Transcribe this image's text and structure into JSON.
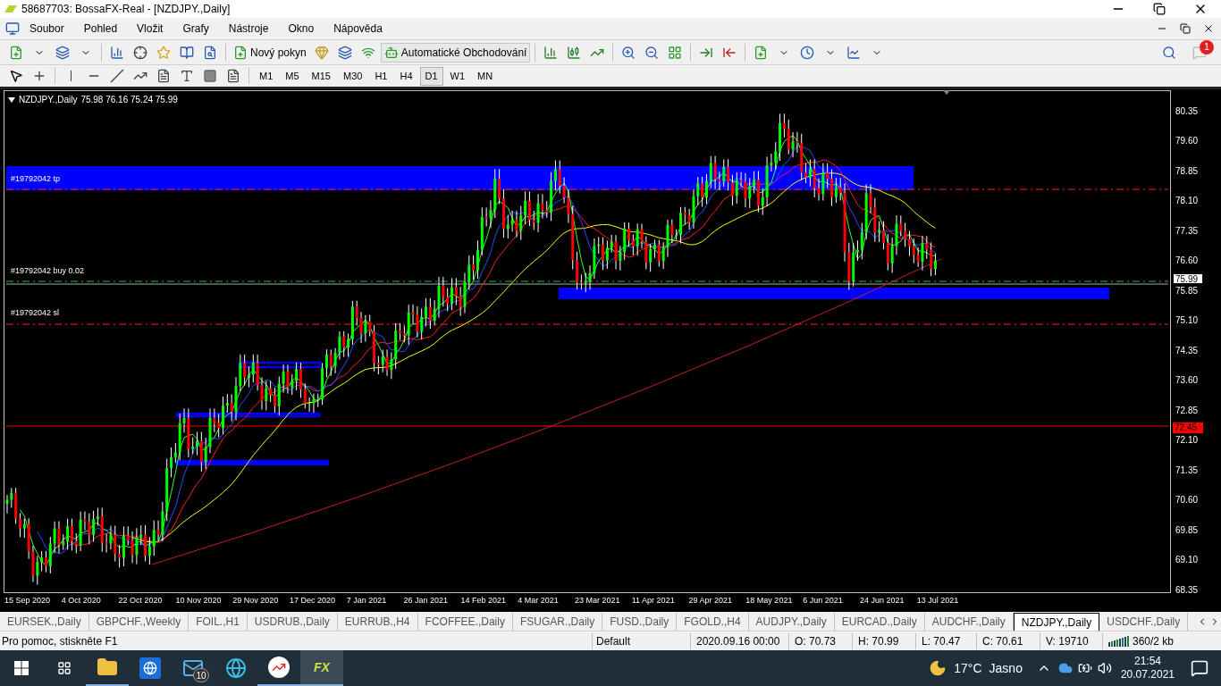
{
  "window": {
    "title": "58687703: BossaFX-Real - [NZDJPY.,Daily]"
  },
  "menu": [
    "Soubor",
    "Pohled",
    "Vložit",
    "Grafy",
    "Nástroje",
    "Okno",
    "Nápověda"
  ],
  "toolbar": {
    "new_order": "Nový pokyn",
    "auto_trading": "Automatické Obchodování",
    "notifications": "1"
  },
  "timeframes": [
    {
      "label": "M1",
      "selected": false
    },
    {
      "label": "M5",
      "selected": false
    },
    {
      "label": "M15",
      "selected": false
    },
    {
      "label": "M30",
      "selected": false
    },
    {
      "label": "H1",
      "selected": false
    },
    {
      "label": "H4",
      "selected": false
    },
    {
      "label": "D1",
      "selected": true
    },
    {
      "label": "W1",
      "selected": false
    },
    {
      "label": "MN",
      "selected": false
    }
  ],
  "chart": {
    "symbol": "NZDJPY.,Daily",
    "ohlc": "75.98 76.16 75.24 75.99",
    "order_labels": [
      {
        "text": "#19792042 tp",
        "kind": "tp"
      },
      {
        "text": "#19792042 buy 0.02",
        "kind": "buy"
      },
      {
        "text": "#19792042 sl",
        "kind": "sl"
      }
    ],
    "price_ticks": [
      "80.35",
      "79.60",
      "78.85",
      "78.10",
      "77.35",
      "76.60",
      "75.85",
      "75.10",
      "74.35",
      "73.60",
      "72.85",
      "72.10",
      "71.35",
      "70.60",
      "69.85",
      "69.10",
      "68.35"
    ],
    "price_tags": [
      {
        "text": "75.99",
        "kind": "bid"
      },
      {
        "text": "72.45",
        "kind": "level"
      }
    ],
    "dates": [
      "15 Sep 2020",
      "4 Oct 2020",
      "22 Oct 2020",
      "10 Nov 2020",
      "29 Nov 2020",
      "17 Dec 2020",
      "7 Jan 2021",
      "26 Jan 2021",
      "14 Feb 2021",
      "4 Mar 2021",
      "23 Mar 2021",
      "11 Apr 2021",
      "29 Apr 2021",
      "18 May 2021",
      "6 Jun 2021",
      "24 Jun 2021",
      "13 Jul 2021"
    ]
  },
  "chart_tabs": [
    {
      "label": "EURSEK.,Daily",
      "selected": false
    },
    {
      "label": "GBPCHF.,Weekly",
      "selected": false
    },
    {
      "label": "FOIL.,H1",
      "selected": false
    },
    {
      "label": "USDRUB.,Daily",
      "selected": false
    },
    {
      "label": "EURRUB.,H4",
      "selected": false
    },
    {
      "label": "FCOFFEE.,Daily",
      "selected": false
    },
    {
      "label": "FSUGAR.,Daily",
      "selected": false
    },
    {
      "label": "FUSD.,Daily",
      "selected": false
    },
    {
      "label": "FGOLD.,H4",
      "selected": false
    },
    {
      "label": "AUDJPY.,Daily",
      "selected": false
    },
    {
      "label": "EURCAD.,Daily",
      "selected": false
    },
    {
      "label": "AUDCHF.,Daily",
      "selected": false
    },
    {
      "label": "NZDJPY.,Daily",
      "selected": true
    },
    {
      "label": "USDCHF.,Daily",
      "selected": false
    }
  ],
  "status_bar": {
    "help": "Pro pomoc, stiskněte F1",
    "profile": "Default",
    "time": "2020.09.16 00:00",
    "open": "O: 70.73",
    "high": "H: 70.99",
    "low": "L: 70.47",
    "close": "C: 70.61",
    "volume": "V: 19710",
    "traffic": "360/2 kb"
  },
  "taskbar": {
    "mail_badge": "10",
    "app_logo": "FX",
    "temperature": "17°C",
    "weather": "Jasno",
    "time": "21:54",
    "date": "20.07.2021"
  }
}
